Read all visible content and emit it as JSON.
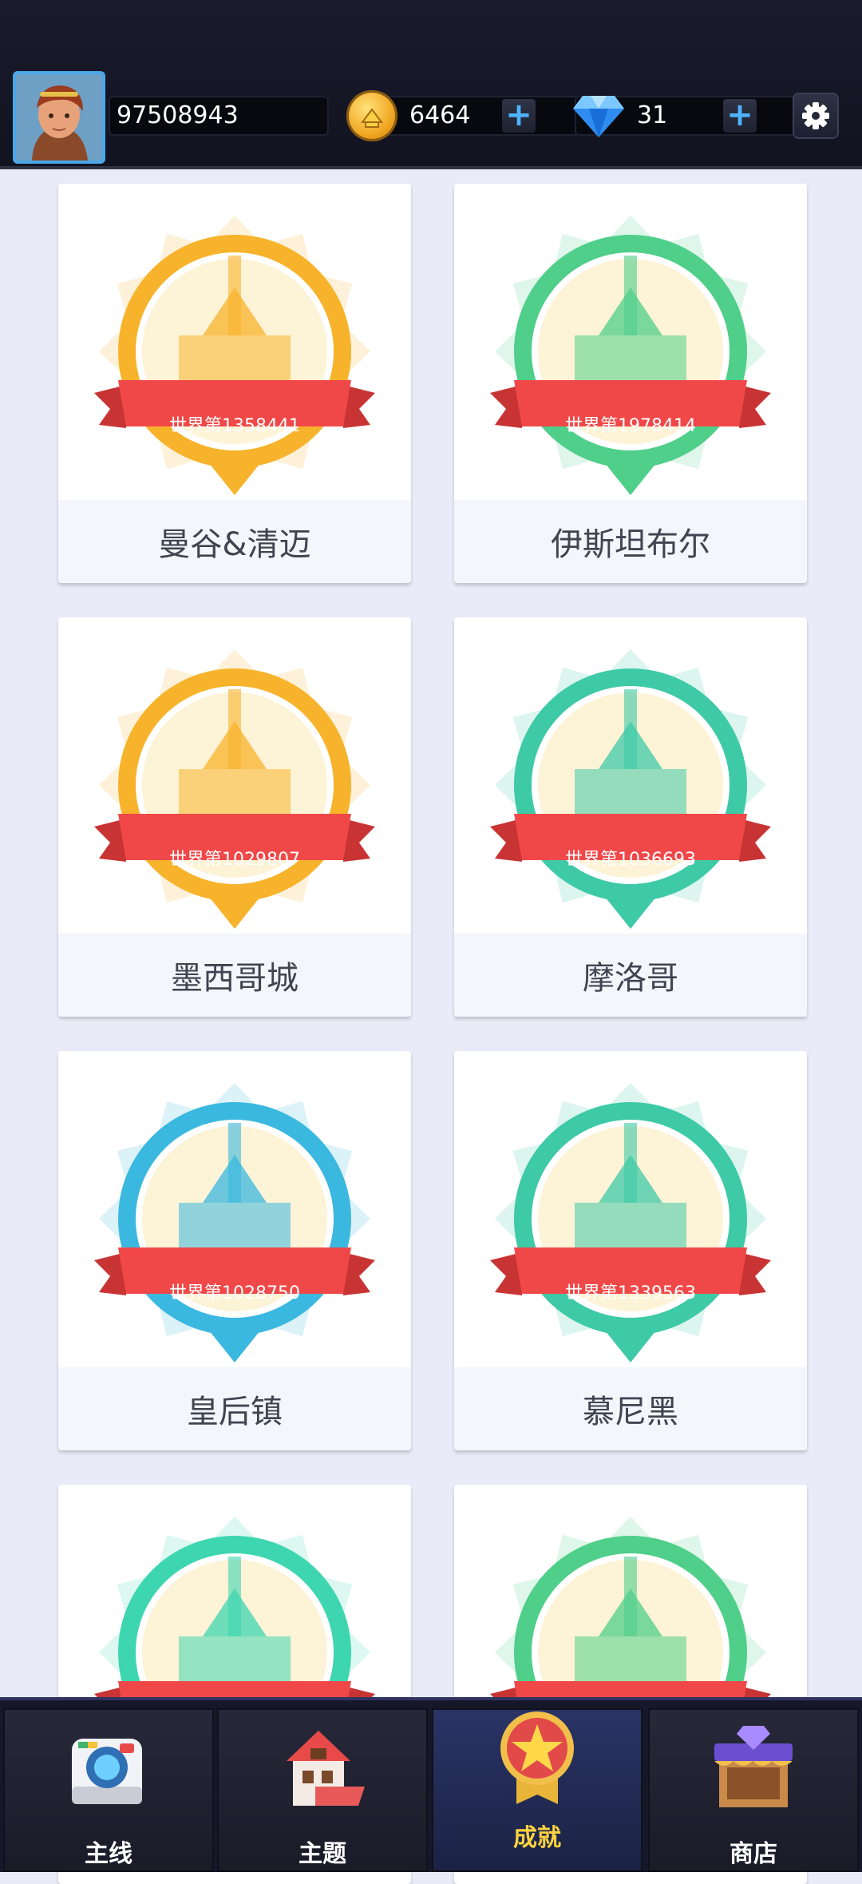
{
  "header": {
    "player_id": "97508943",
    "coins": "6464",
    "gems": "31",
    "coin_plus": "+",
    "gem_plus": "+"
  },
  "cities": [
    {
      "name": "曼谷&清迈",
      "rank": "世界第1358441",
      "color": "#f7b32b"
    },
    {
      "name": "伊斯坦布尔",
      "rank": "世界第1978414",
      "color": "#4fcf8a"
    },
    {
      "name": "墨西哥城",
      "rank": "世界第1029807",
      "color": "#f7b32b"
    },
    {
      "name": "摩洛哥",
      "rank": "世界第1036693",
      "color": "#3ec9a7"
    },
    {
      "name": "皇后镇",
      "rank": "世界第1028750",
      "color": "#3bb8e0"
    },
    {
      "name": "慕尼黑",
      "rank": "世界第1339563",
      "color": "#3ec9a7"
    },
    {
      "name": "",
      "rank": "",
      "color": "#3ed6b0"
    },
    {
      "name": "",
      "rank": "",
      "color": "#4fcf8a"
    }
  ],
  "nav": {
    "items": [
      {
        "label": "主线",
        "icon": "camera-icon"
      },
      {
        "label": "主题",
        "icon": "house-icon"
      },
      {
        "label": "成就",
        "icon": "star-medal-icon",
        "active": true
      },
      {
        "label": "商店",
        "icon": "shop-icon"
      }
    ]
  },
  "colors": {
    "accent_blue": "#4fb3ff",
    "ribbon_red": "#f04848",
    "active_tab_text": "#ffd23f"
  }
}
